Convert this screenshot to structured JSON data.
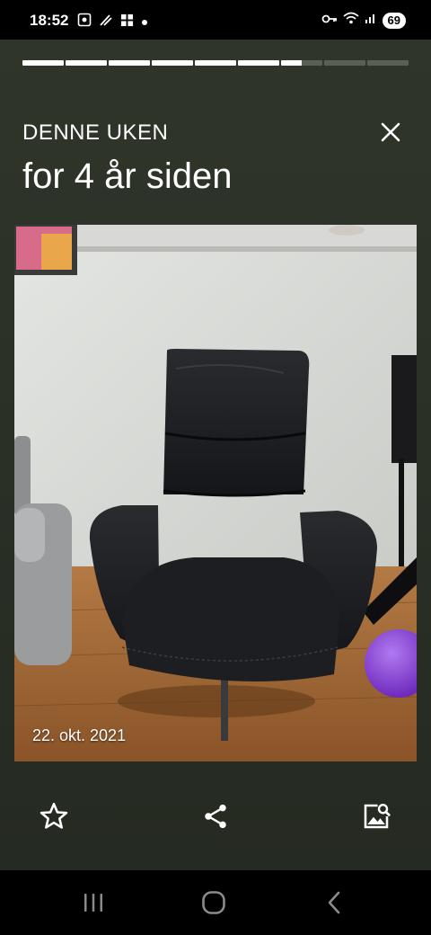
{
  "status_bar": {
    "time": "18:52",
    "battery": "69",
    "left_icons": [
      "screen-record-icon",
      "sparkle-icon",
      "gallery-icon",
      "dot-icon"
    ],
    "right_icons": [
      "key-icon",
      "wifi-icon",
      "signal-icon",
      "battery-icon"
    ]
  },
  "progress": {
    "segments": 9,
    "current_segment": 7,
    "current_fraction": 0.5
  },
  "header": {
    "title": "DENNE UKEN",
    "subtitle": "for 4 år siden"
  },
  "photo": {
    "date": "22. okt. 2021",
    "description_icon": "armchair-photo"
  },
  "actions": {
    "favorite": "star-icon",
    "share": "share-icon",
    "gallery": "image-search-icon"
  },
  "nav": {
    "recents": "recents-icon",
    "home": "home-icon",
    "back": "back-icon"
  },
  "colors": {
    "background": "#2a3026",
    "progress_track": "#5a5f55",
    "progress_fill": "#ffffff",
    "ball": "#8a3fd6"
  }
}
